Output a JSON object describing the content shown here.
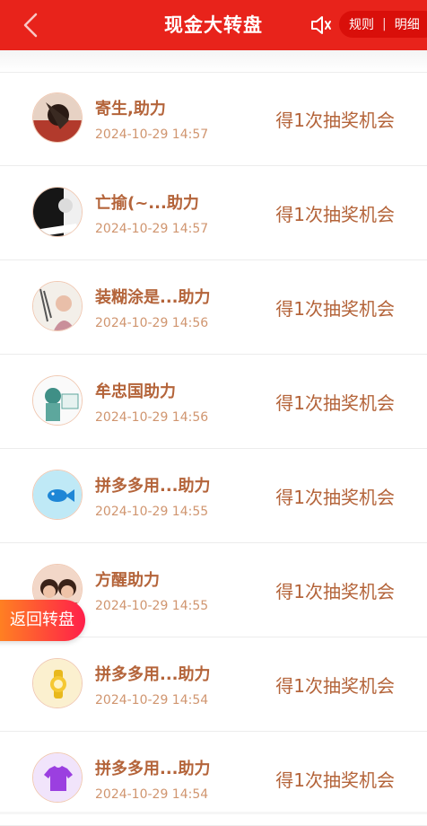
{
  "header": {
    "title": "现金大转盘",
    "back_icon": "chevron-left-icon",
    "sound_icon": "speaker-icon",
    "rules_label": "规则",
    "detail_label": "明细",
    "separator": "|",
    "bg_color": "#e8231b"
  },
  "records": [
    {
      "name": "寄生,助力",
      "time": "2024-10-29 14:57",
      "reward": "得1次抽奖机会",
      "avatar_icon": "photo-avatar"
    },
    {
      "name": "亡揄(~...助力",
      "time": "2024-10-29 14:57",
      "reward": "得1次抽奖机会",
      "avatar_icon": "photo-avatar"
    },
    {
      "name": "装糊涂是...助力",
      "time": "2024-10-29 14:56",
      "reward": "得1次抽奖机会",
      "avatar_icon": "photo-avatar"
    },
    {
      "name": "牟忠国助力",
      "time": "2024-10-29 14:56",
      "reward": "得1次抽奖机会",
      "avatar_icon": "photo-avatar"
    },
    {
      "name": "拼多多用...助力",
      "time": "2024-10-29 14:55",
      "reward": "得1次抽奖机会",
      "avatar_icon": "fish-icon"
    },
    {
      "name": "方醒助力",
      "time": "2024-10-29 14:55",
      "reward": "得1次抽奖机会",
      "avatar_icon": "photo-avatar"
    },
    {
      "name": "拼多多用...助力",
      "time": "2024-10-29 14:54",
      "reward": "得1次抽奖机会",
      "avatar_icon": "watch-icon"
    },
    {
      "name": "拼多多用...助力",
      "time": "2024-10-29 14:54",
      "reward": "得1次抽奖机会",
      "avatar_icon": "tshirt-icon"
    }
  ],
  "float_button": {
    "label": "返回转盘"
  }
}
